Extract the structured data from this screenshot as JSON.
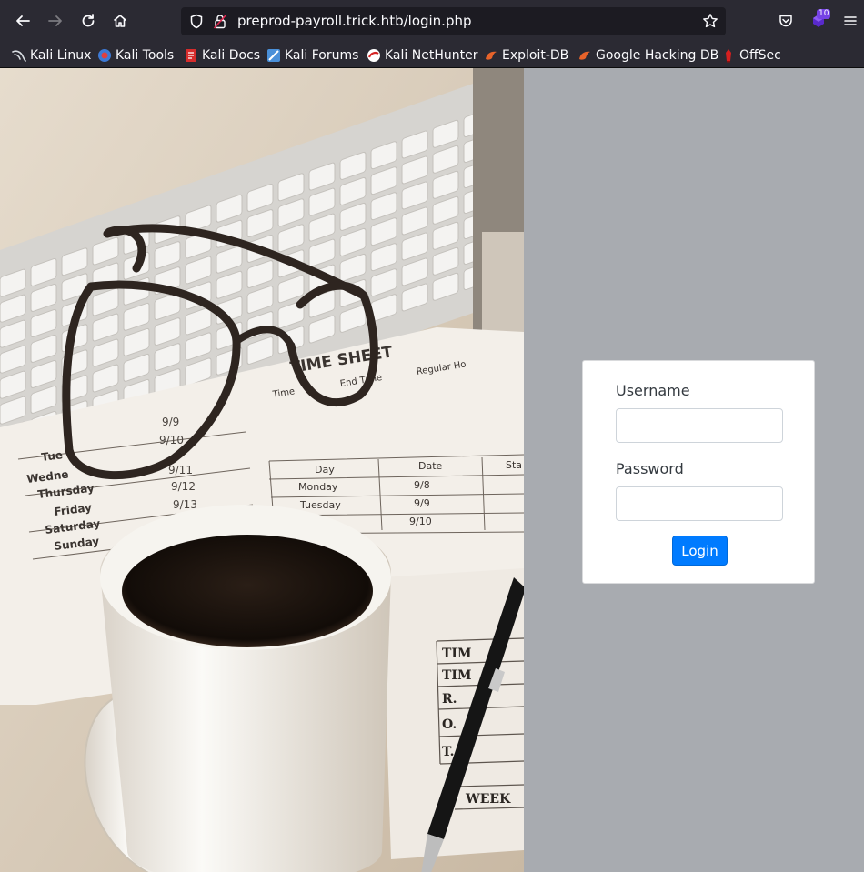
{
  "browser": {
    "url": "preprod-payroll.trick.htb/login.php",
    "extension_badge": "10",
    "bookmarks": [
      {
        "label": "Kali Linux"
      },
      {
        "label": "Kali Tools"
      },
      {
        "label": "Kali Docs"
      },
      {
        "label": "Kali Forums"
      },
      {
        "label": "Kali NetHunter"
      },
      {
        "label": "Exploit-DB"
      },
      {
        "label": "Google Hacking DB"
      },
      {
        "label": "OffSec"
      }
    ]
  },
  "photo": {
    "sheet_title": "TIME SHEET",
    "header_cells": [
      "Time",
      "End Time",
      "Regular Ho"
    ],
    "days_left": [
      "Tue",
      "Wedne",
      "Thursday",
      "Friday",
      "Saturday",
      "Sunday"
    ],
    "dates_left": [
      "9/9",
      "9/10",
      "9/11",
      "9/12",
      "9/13"
    ],
    "table_headers": [
      "Day",
      "Date",
      "Sta"
    ],
    "table_rows": [
      [
        "Monday",
        "9/8"
      ],
      [
        "Tuesday",
        "9/9"
      ],
      [
        "",
        "9/10"
      ]
    ],
    "bottom_sheet": [
      "TIM",
      "TIM",
      "R.",
      "O.",
      "T.",
      "WEEK"
    ]
  },
  "login": {
    "username_label": "Username",
    "username_value": "",
    "password_label": "Password",
    "password_value": "",
    "submit_label": "Login"
  },
  "colors": {
    "page_background": "#a8abb0",
    "primary_button": "#007bff",
    "chrome": "#2b2a33"
  }
}
